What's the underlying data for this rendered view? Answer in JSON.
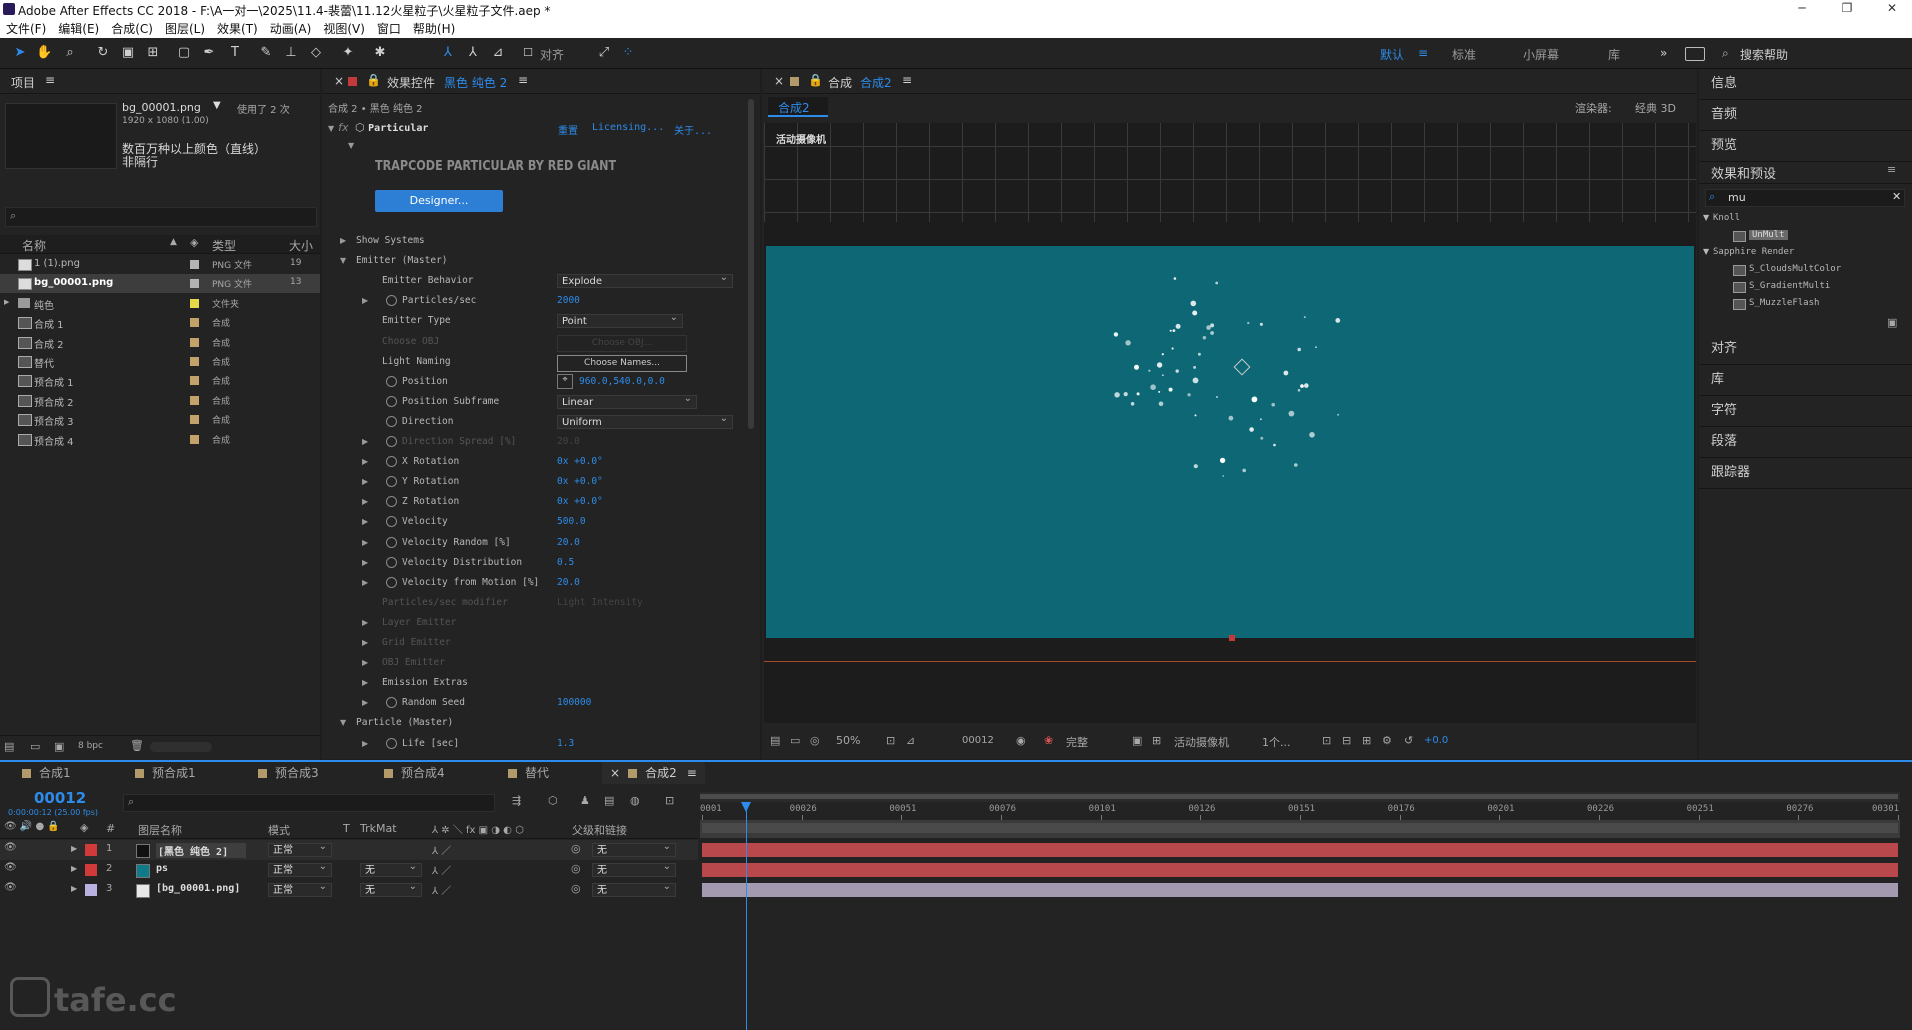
{
  "titlebar": {
    "app": "Adobe After Effects CC 2018 - F:\\A一对一\\2025\\11.4-裴蕾\\11.12火星粒子\\火星粒子文件.aep *",
    "min": "─",
    "max": "❐",
    "close": "✕"
  },
  "menu": [
    "文件(F)",
    "编辑(E)",
    "合成(C)",
    "图层(L)",
    "效果(T)",
    "动画(A)",
    "视图(V)",
    "窗口",
    "帮助(H)"
  ],
  "toolbar": {
    "align_label": "对齐",
    "workspaces": [
      "默认",
      "标准",
      "小屏幕",
      "库"
    ],
    "more": "»",
    "search_placeholder": "搜索帮助"
  },
  "project": {
    "title": "项目",
    "thumb_name": "bg_00001.png",
    "thumb_used": "使用了 2 次",
    "thumb_dims": "1920 x 1080 (1.00)",
    "thumb_line1": "数百万种以上颜色（直线）",
    "thumb_line2": "非隔行",
    "search_placeholder": "",
    "cols": {
      "name": "名称",
      "type": "类型",
      "size": "大小"
    },
    "items": [
      {
        "name": "1 (1).png",
        "color": "#b4b4b4",
        "type": "PNG 文件",
        "size": "19"
      },
      {
        "name": "bg_00001.png",
        "color": "#b4b4b4",
        "type": "PNG 文件",
        "size": "13"
      },
      {
        "name": "纯色",
        "color": "#e6d94a",
        "type": "文件夹",
        "size": ""
      },
      {
        "name": "合成 1",
        "color": "#c2a26a",
        "type": "合成",
        "size": ""
      },
      {
        "name": "合成 2",
        "color": "#c2a26a",
        "type": "合成",
        "size": ""
      },
      {
        "name": "替代",
        "color": "#c2a26a",
        "type": "合成",
        "size": ""
      },
      {
        "name": "预合成 1",
        "color": "#c2a26a",
        "type": "合成",
        "size": ""
      },
      {
        "name": "预合成 2",
        "color": "#c2a26a",
        "type": "合成",
        "size": ""
      },
      {
        "name": "预合成 3",
        "color": "#c2a26a",
        "type": "合成",
        "size": ""
      },
      {
        "name": "预合成 4",
        "color": "#c2a26a",
        "type": "合成",
        "size": ""
      }
    ],
    "bpc": "8 bpc"
  },
  "effects": {
    "tab_prefix": "效果控件",
    "tab_layer": "黑色 纯色 2",
    "path": "合成 2 • 黑色 纯色 2",
    "fx_name": "Particular",
    "reset": "重置",
    "licensing": "Licensing...",
    "about": "关于...",
    "brand": "TRAPCODE PARTICULAR BY RED GIANT",
    "designer": "Designer...",
    "props": [
      {
        "label": "Show Systems",
        "value": "",
        "indent": 0,
        "tri": "▶",
        "sw": false,
        "dim": false
      },
      {
        "label": "Emitter (Master)",
        "value": "",
        "indent": 0,
        "tri": "▼",
        "sw": false,
        "dim": false
      },
      {
        "label": "Emitter Behavior",
        "value": "",
        "indent": 1,
        "tri": "",
        "sw": false,
        "dim": false,
        "dd": "Explode"
      },
      {
        "label": "Particles/sec",
        "value": "2000",
        "indent": 1,
        "tri": "▶",
        "sw": true,
        "dim": false
      },
      {
        "label": "Emitter Type",
        "value": "",
        "indent": 1,
        "tri": "",
        "sw": false,
        "dim": false,
        "dd": "Point"
      },
      {
        "label": "Choose OBJ",
        "value": "",
        "indent": 1,
        "tri": "",
        "sw": false,
        "dim": true,
        "btn": "Choose OBJ..."
      },
      {
        "label": "Light Naming",
        "value": "",
        "indent": 1,
        "tri": "",
        "sw": false,
        "dim": false,
        "btn": "Choose Names..."
      },
      {
        "label": "Position",
        "value": "960.0,540.0,0.0",
        "indent": 1,
        "tri": "",
        "sw": true,
        "dim": false
      },
      {
        "label": "Position Subframe",
        "value": "",
        "indent": 1,
        "tri": "",
        "sw": true,
        "dim": false,
        "dd": "Linear"
      },
      {
        "label": "Direction",
        "value": "",
        "indent": 1,
        "tri": "",
        "sw": true,
        "dim": false,
        "dd": "Uniform"
      },
      {
        "label": "Direction Spread [%]",
        "value": "20.0",
        "indent": 1,
        "tri": "▶",
        "sw": true,
        "dim": true
      },
      {
        "label": "X Rotation",
        "value": "0x +0.0°",
        "indent": 1,
        "tri": "▶",
        "sw": true,
        "dim": false
      },
      {
        "label": "Y Rotation",
        "value": "0x +0.0°",
        "indent": 1,
        "tri": "▶",
        "sw": true,
        "dim": false
      },
      {
        "label": "Z Rotation",
        "value": "0x +0.0°",
        "indent": 1,
        "tri": "▶",
        "sw": true,
        "dim": false
      },
      {
        "label": "Velocity",
        "value": "500.0",
        "indent": 1,
        "tri": "▶",
        "sw": true,
        "dim": false
      },
      {
        "label": "Velocity Random [%]",
        "value": "20.0",
        "indent": 1,
        "tri": "▶",
        "sw": true,
        "dim": false
      },
      {
        "label": "Velocity Distribution",
        "value": "0.5",
        "indent": 1,
        "tri": "▶",
        "sw": true,
        "dim": false
      },
      {
        "label": "Velocity from Motion [%]",
        "value": "20.0",
        "indent": 1,
        "tri": "▶",
        "sw": true,
        "dim": false
      },
      {
        "label": "Particles/sec modifier",
        "value": "Light Intensity",
        "indent": 1,
        "tri": "",
        "sw": false,
        "dim": true
      },
      {
        "label": "Layer Emitter",
        "value": "",
        "indent": 1,
        "tri": "▶",
        "sw": false,
        "dim": true
      },
      {
        "label": "Grid Emitter",
        "value": "",
        "indent": 1,
        "tri": "▶",
        "sw": false,
        "dim": true
      },
      {
        "label": "OBJ Emitter",
        "value": "",
        "indent": 1,
        "tri": "▶",
        "sw": false,
        "dim": true
      },
      {
        "label": "Emission Extras",
        "value": "",
        "indent": 1,
        "tri": "▶",
        "sw": false,
        "dim": false
      },
      {
        "label": "Random Seed",
        "value": "100000",
        "indent": 1,
        "tri": "▶",
        "sw": true,
        "dim": false
      },
      {
        "label": "Particle (Master)",
        "value": "",
        "indent": 0,
        "tri": "▼",
        "sw": false,
        "dim": false
      },
      {
        "label": "Life [sec]",
        "value": "1.3",
        "indent": 1,
        "tri": "▶",
        "sw": true,
        "dim": false
      }
    ]
  },
  "comp": {
    "tab_prefix": "合成",
    "tab_name": "合成2",
    "subtab": "合成2",
    "renderer_label": "渲染器:",
    "renderer_value": "经典 3D",
    "camera_label": "活动摄像机",
    "zoom": "50%",
    "frame": "00012",
    "quality": "完整",
    "view": "活动摄像机",
    "views": "1个...",
    "exposure": "+0.0"
  },
  "right": {
    "top_items": [
      "信息",
      "音频",
      "预览"
    ],
    "fx_title": "效果和预设",
    "search_value": "mu",
    "tree": [
      {
        "label": "Knoll",
        "level": 0,
        "tri": "▼"
      },
      {
        "label": "UnMult",
        "level": 1,
        "tri": "",
        "sel": true
      },
      {
        "label": "Sapphire Render",
        "level": 0,
        "tri": "▼"
      },
      {
        "label": "S_CloudsMultColor",
        "level": 1,
        "tri": ""
      },
      {
        "label": "S_GradientMulti",
        "level": 1,
        "tri": ""
      },
      {
        "label": "S_MuzzleFlash",
        "level": 1,
        "tri": ""
      }
    ],
    "bottom_items": [
      "对齐",
      "库",
      "字符",
      "段落",
      "跟踪器"
    ]
  },
  "timeline": {
    "tabs": [
      {
        "label": "合成1",
        "active": false
      },
      {
        "label": "预合成1",
        "active": false
      },
      {
        "label": "预合成3",
        "active": false
      },
      {
        "label": "预合成4",
        "active": false
      },
      {
        "label": "替代",
        "active": false
      },
      {
        "label": "合成2",
        "active": true
      }
    ],
    "timecode": "00012",
    "timecode_sub": "0:00:00:12 (25.00 fps)",
    "cols": {
      "num": "#",
      "name": "图层名称",
      "mode": "模式",
      "t": "T",
      "trkmat": "TrkMat",
      "parent": "父级和链接"
    },
    "ruler": [
      "0001",
      "00026",
      "00051",
      "00076",
      "00101",
      "00126",
      "00151",
      "00176",
      "00201",
      "00226",
      "00251",
      "00276",
      "00301"
    ],
    "layers": [
      {
        "num": "1",
        "name": "[黑色 纯色 2]",
        "label_color": "#d03a3a",
        "icon_color": "#111111",
        "mode": "正常",
        "trkmat": "",
        "parent": "无",
        "bar_color": "#b8484c",
        "selected": true
      },
      {
        "num": "2",
        "name": "ps",
        "label_color": "#d03a3a",
        "icon_color": "#0d7b8a",
        "mode": "正常",
        "trkmat": "无",
        "parent": "无",
        "bar_color": "#b8484c",
        "selected": false
      },
      {
        "num": "3",
        "name": "[bg_00001.png]",
        "label_color": "#b9b1e0",
        "icon_color": "#e8e8e8",
        "mode": "正常",
        "trkmat": "无",
        "parent": "无",
        "bar_color": "#a49ab0",
        "selected": false
      }
    ],
    "playhead_frame": 12,
    "range": [
      1,
      301
    ]
  },
  "watermark": "tafe.cc",
  "colors": {
    "accent": "#2d8ceb",
    "comp_bg": "#0d6775",
    "panel": "#232323"
  }
}
